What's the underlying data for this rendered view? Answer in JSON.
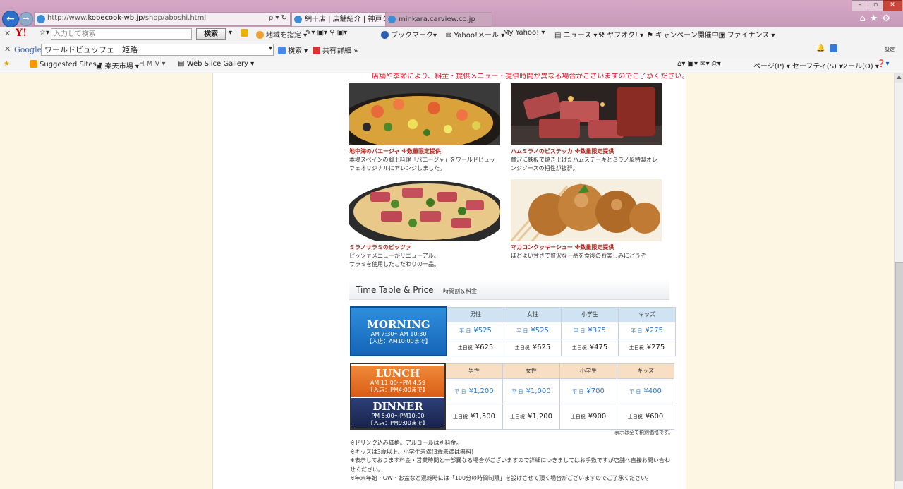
{
  "browser": {
    "url_prefix": "http://www.",
    "url_domain": "kobecook-wb.jp",
    "url_path": "/shop/aboshi.html",
    "addr_controls": "ρ ▾ ↻",
    "tabs": [
      {
        "label": "網干店 | 店舗紹介 | 神戸ク..."
      },
      {
        "label": "minkara.carview.co.jp"
      }
    ],
    "window": {
      "min": "–",
      "max": "▫",
      "close": "✕"
    },
    "top_icons": "⌂★⚙"
  },
  "yahoo_bar": {
    "logo": "Y!",
    "search_placeholder": "入力して検索",
    "search_button": "検索",
    "items": [
      "地域を指定",
      "ブックマーク",
      "Yahoo!メール",
      "My Yahoo!",
      "ニュース",
      "ヤフオク!",
      "キャンペーン開催中",
      "ファイナンス"
    ]
  },
  "google_bar": {
    "logo": "Google",
    "query": "ワールドビュッフェ　姫路",
    "search": "検索",
    "share": "共有",
    "more": "詳細",
    "more_arrow": "»",
    "settings": "設定"
  },
  "fav_bar": {
    "items": [
      "Suggested Sites",
      "楽天市場",
      "H M V",
      "Web Slice Gallery"
    ],
    "right_items": [
      "ページ(P)",
      "セーフティ(S)",
      "ツール(O)"
    ]
  },
  "notice": "店舗や季節により、料金・提供メニュー・提供時間が異なる場合がございますのでご了承ください。",
  "foods": [
    {
      "name": "地中海のパエージャ ※数量限定提供",
      "desc": "本場スペインの郷土料理「パエージャ」をワールドビュッフェオリジナルにアレンジしました。"
    },
    {
      "name": "ハムミラノのビステッカ ※数量限定提供",
      "desc": "贅沢に鉄板で焼き上げたハムステーキとミラノ風特製オレンジソースの相性が抜群。"
    },
    {
      "name": "ミラノサラミのピッツァ",
      "desc": "ピッツァメニューがリニューアル。サラミを使用したこだわりの一品。"
    },
    {
      "name": "マカロンクッキーシュー ※数量限定提供",
      "desc": "ほどよい甘さで贅沢な一品を食後のお楽しみにどうぞ"
    }
  ],
  "section": {
    "title_en": "Time Table & Price",
    "title_jp": "時間割＆料金"
  },
  "columns": [
    "男性",
    "女性",
    "小学生",
    "キッズ"
  ],
  "weekday_label": "平 日",
  "weekend_label": "土日祝",
  "morning": {
    "title": "MORNING",
    "time": "AM 7:30～AM 10:30",
    "entry": "【入店：AM10:00まで】",
    "weekday": [
      "¥525",
      "¥525",
      "¥375",
      "¥275"
    ],
    "weekend": [
      "¥625",
      "¥625",
      "¥475",
      "¥275"
    ]
  },
  "lunch": {
    "title": "LUNCH",
    "time": "AM 11:00～PM 4:59",
    "entry": "【入店：PM4:00まで】"
  },
  "dinner": {
    "title": "DINNER",
    "time": "PM 5:00～PM10:00",
    "entry": "【入店：PM9:00まで】"
  },
  "ld_prices": {
    "weekday": [
      "¥1,200",
      "¥1,000",
      "¥700",
      "¥400"
    ],
    "weekend": [
      "¥1,500",
      "¥1,200",
      "¥900",
      "¥600"
    ]
  },
  "tax_note": "表示は全て税別価格です。",
  "notes": [
    "※ドリンク込み価格。アルコールは別料金。",
    "※キッズは3歳以上、小学生未満(3歳未満は無料)",
    "※表示しております料金・営業時間と一部異なる場合がございますので詳細につきましてはお手数ですが店舗へ直接お問い合わせください。",
    "※年末年始・GW・お盆など混雑時には「100分の時間制限」を設けさせて頂く場合がございますのでご了承ください。"
  ],
  "colors": {
    "morning": "#1f7fd0",
    "lunch": "#e8702a",
    "dinner": "#1d2c5a",
    "notice": "#dd1122"
  }
}
